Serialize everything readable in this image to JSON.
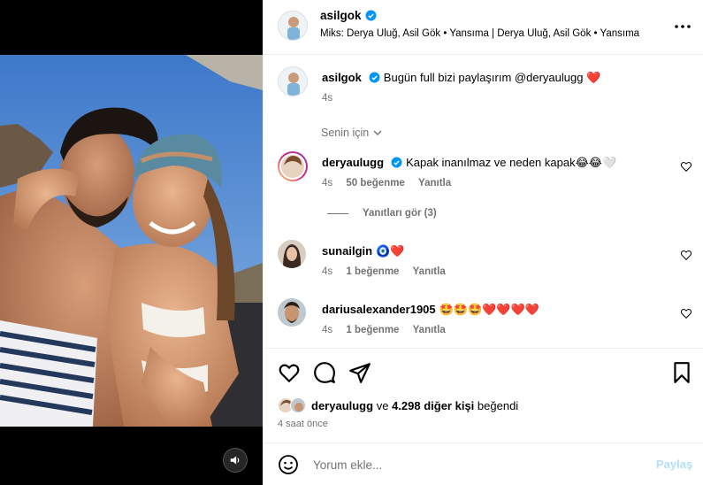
{
  "post": {
    "author": "asilgok",
    "music": "Miks: Derya Uluğ, Asil Gök • Yansıma | Derya Uluğ, Asil Gök • Yansıma",
    "caption": "Bugün full bizi paylaşırım @deryaulugg",
    "caption_emoji": "❤️",
    "caption_time": "4s",
    "for_you_label": "Senin için"
  },
  "comments": [
    {
      "username": "deryaulugg",
      "verified": true,
      "text": "Kapak inanılmaz ve neden kapak😂😂🤍",
      "time": "4s",
      "likes": "50 beğenme",
      "reply": "Yanıtla"
    },
    {
      "username": "sunailgin",
      "verified": false,
      "text": "🧿❤️",
      "time": "4s",
      "likes": "1 beğenme",
      "reply": "Yanıtla"
    },
    {
      "username": "dariusalexander1905",
      "verified": false,
      "text": "🤩🤩🤩❤️❤️❤️❤️",
      "time": "4s",
      "likes": "1 beğenme",
      "reply": "Yanıtla"
    }
  ],
  "view_replies": "Yanıtları gör (3)",
  "likes_summary": {
    "user": "deryaulugg",
    "connector": "ve",
    "others": "4.298 diğer kişi",
    "suffix": "beğendi"
  },
  "time_ago": "4 saat önce",
  "add_comment": {
    "placeholder": "Yorum ekle...",
    "post_label": "Paylaş"
  },
  "colors": {
    "verified_blue": "#0095f6",
    "muted_text": "#737373",
    "post_disabled": "#b2dffc",
    "heart_red": "#ed1c24"
  },
  "icons": [
    "verified-badge-icon",
    "more-options-icon",
    "chevron-down-icon",
    "heart-icon",
    "comment-icon",
    "share-icon",
    "bookmark-icon",
    "emoji-icon",
    "volume-icon"
  ]
}
